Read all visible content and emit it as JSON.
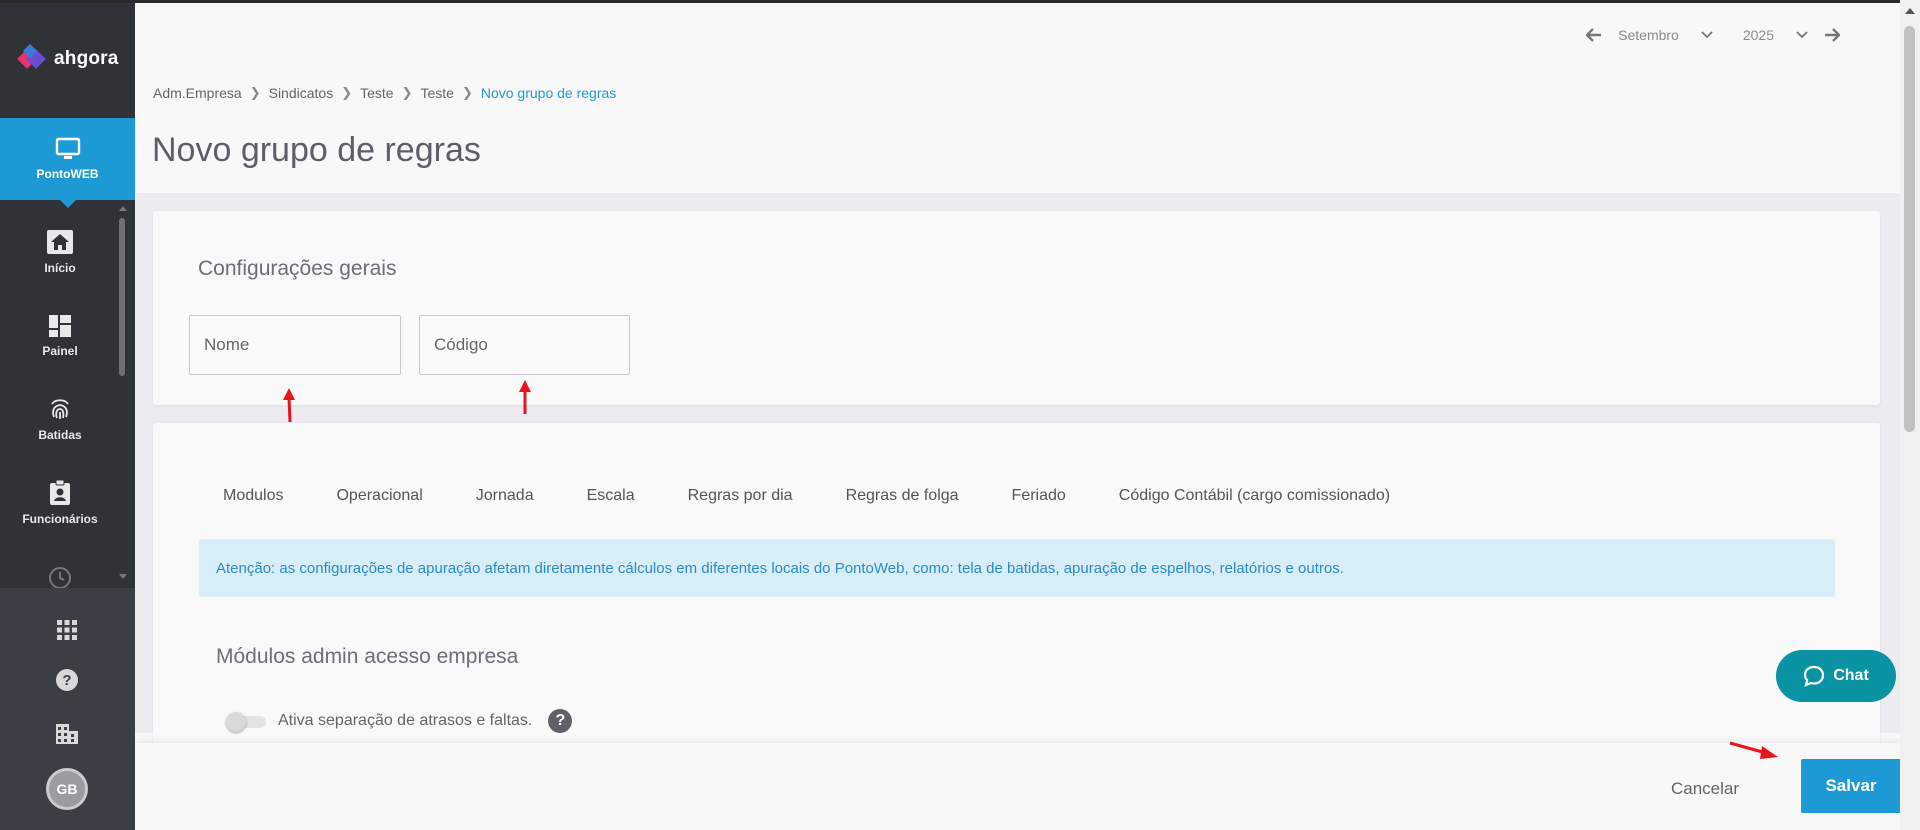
{
  "app": {
    "logo_text": "ahgora"
  },
  "sidebar": {
    "active": {
      "label": "PontoWEB",
      "icon": "monitor-icon"
    },
    "items": [
      {
        "label": "Início",
        "icon": "home-icon"
      },
      {
        "label": "Painel",
        "icon": "dashboard-icon"
      },
      {
        "label": "Batidas",
        "icon": "fingerprint-icon"
      },
      {
        "label": "Funcionários",
        "icon": "badge-icon"
      }
    ],
    "bottom_icons": [
      "apps-grid-icon",
      "help-icon",
      "building-icon"
    ],
    "avatar": "GB"
  },
  "topbar": {
    "month": "Setembro",
    "year": "2025"
  },
  "breadcrumb": [
    "Adm.Empresa",
    "Sindicatos",
    "Teste",
    "Teste",
    "Novo grupo de regras"
  ],
  "page_title": "Novo grupo de regras",
  "general": {
    "title": "Configurações gerais",
    "name_placeholder": "Nome",
    "code_placeholder": "Código"
  },
  "tabs": [
    "Modulos",
    "Operacional",
    "Jornada",
    "Escala",
    "Regras por dia",
    "Regras de folga",
    "Feriado",
    "Código Contábil (cargo comissionado)"
  ],
  "alert": "Atenção: as configurações de apuração afetam diretamente cálculos em diferentes locais do PontoWeb, como: tela de batidas, apuração de espelhos, relatórios e outros.",
  "modules": {
    "title": "Módulos admin acesso empresa",
    "toggle_label": "Ativa separação de atrasos e faltas.",
    "toggle_on": false
  },
  "footer": {
    "cancel": "Cancelar",
    "save": "Salvar"
  },
  "chat": {
    "label": "Chat"
  },
  "colors": {
    "primary": "#1d9ad6",
    "sidebar": "#2f3237",
    "chat": "#0a94a3",
    "annotation": "#e8141b"
  }
}
